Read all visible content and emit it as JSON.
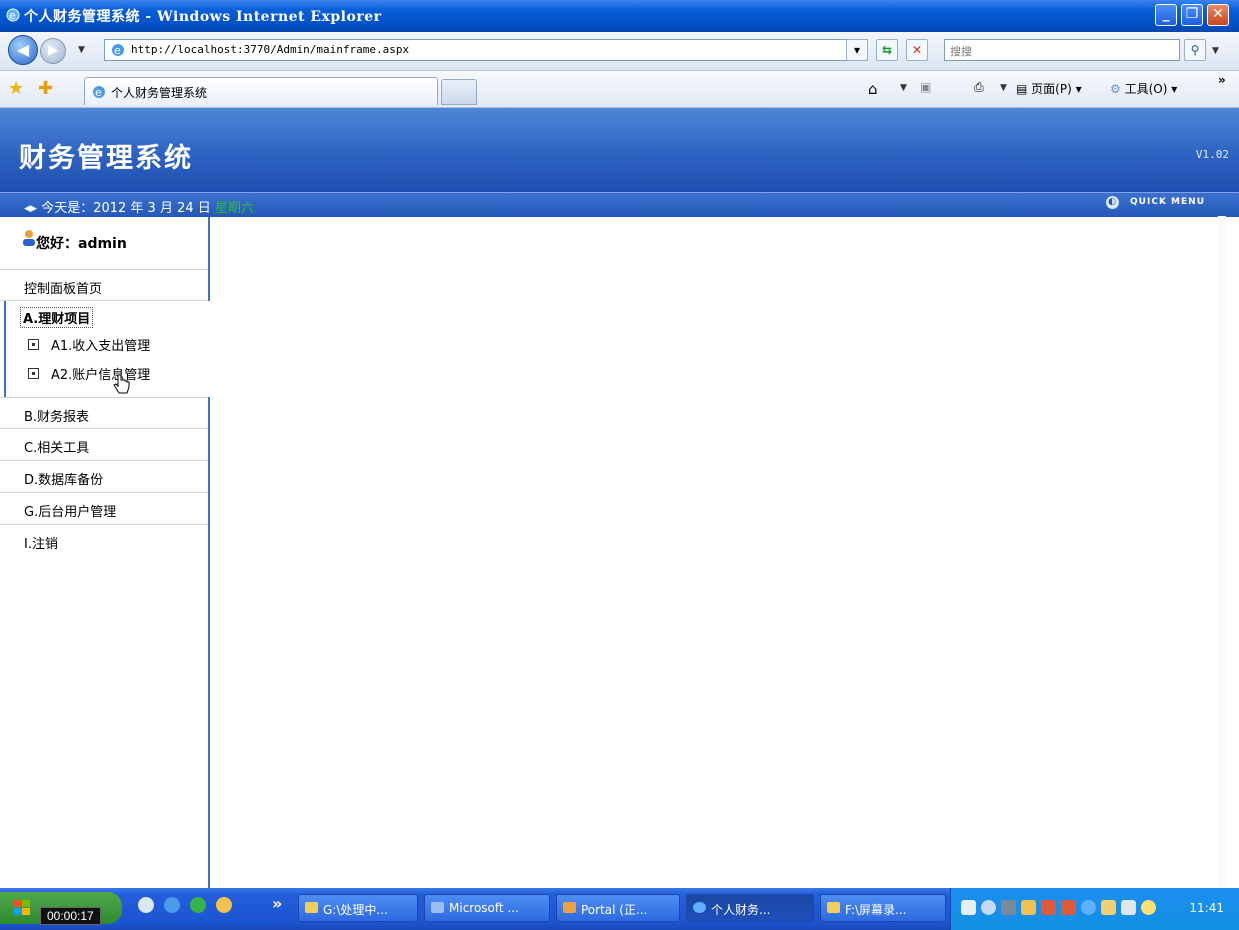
{
  "window": {
    "title": "个人财务管理系统 - Windows Internet Explorer"
  },
  "address_bar": {
    "url": "http://localhost:3770/Admin/mainframe.aspx",
    "search_placeholder": "搜搜"
  },
  "tabs": {
    "active_tab_label": "个人财务管理系统"
  },
  "command_bar": {
    "page_label": "页面(P)",
    "tools_label": "工具(O)"
  },
  "app": {
    "title": "财务管理系统",
    "version": "V1.02",
    "date_prefix": "今天是：2012 年 3 月 24 日",
    "weekday": "星期六",
    "quick_menu": "QUICK MENU",
    "greeting": "您好：admin"
  },
  "sidebar": {
    "home": "控制面板首页",
    "group_a": {
      "title": "A.理财项目",
      "items": [
        "A1.收入支出管理",
        "A2.账户信息管理"
      ]
    },
    "items": [
      "B.财务报表",
      "C.相关工具",
      "D.数据库备份",
      "G.后台用户管理",
      "I.注销"
    ]
  },
  "taskbar": {
    "timer": "00:00:17",
    "buttons": [
      "G:\\处理中...",
      "Microsoft ...",
      "Portal (正...",
      "个人财务...",
      "F:\\屏幕录..."
    ],
    "clock": "11:41"
  },
  "colors": {
    "header_blue": "#2e63c2",
    "weekday_green": "#27c21e",
    "taskbar_blue": "#245edb"
  }
}
